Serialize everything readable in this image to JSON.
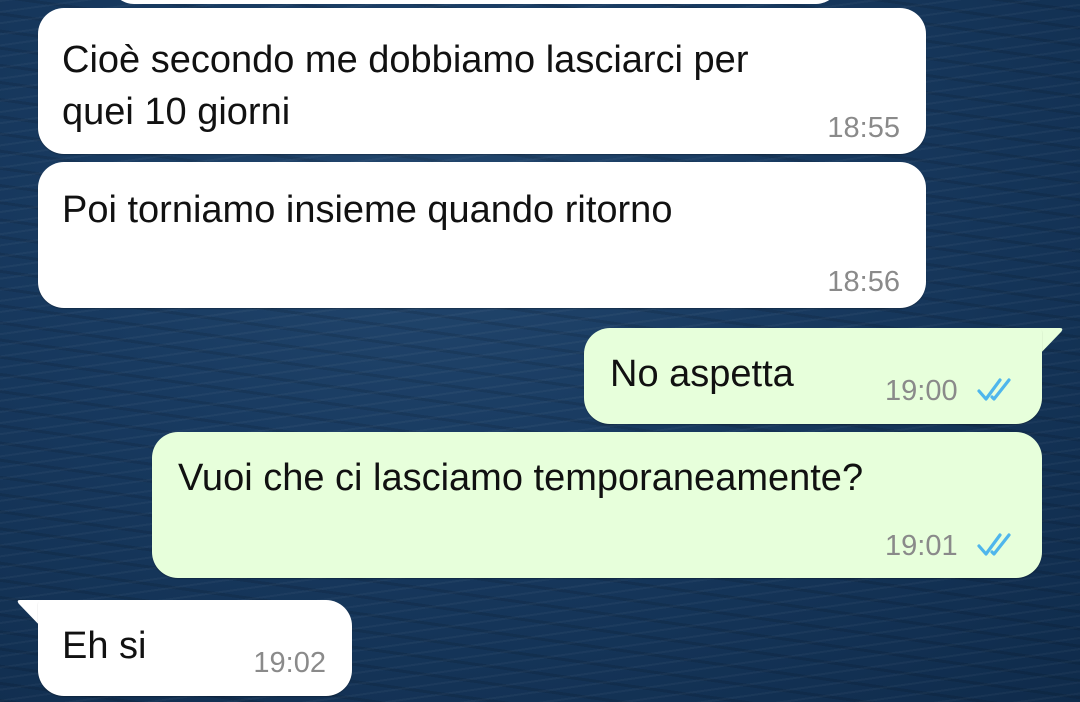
{
  "chat": {
    "messages": [
      {
        "direction": "incoming",
        "text": "Cioè secondo me dobbiamo lasciarci per\nquei 10 giorni",
        "time": "18:55"
      },
      {
        "direction": "incoming",
        "text": "Poi torniamo insieme quando ritorno",
        "time": "18:56"
      },
      {
        "direction": "outgoing",
        "text": "No aspetta",
        "time": "19:00",
        "status": "read"
      },
      {
        "direction": "outgoing",
        "text": "Vuoi che ci lasciamo temporaneamente?",
        "time": "19:01",
        "status": "read"
      },
      {
        "direction": "incoming",
        "text": "Eh si",
        "time": "19:02"
      }
    ]
  },
  "colors": {
    "incoming_bubble": "#ffffff",
    "outgoing_bubble": "#e7ffdb",
    "read_ticks": "#4fb6ec",
    "timestamp": "#8a8a8a"
  },
  "icons": {
    "read_receipt": "double-check-icon"
  }
}
